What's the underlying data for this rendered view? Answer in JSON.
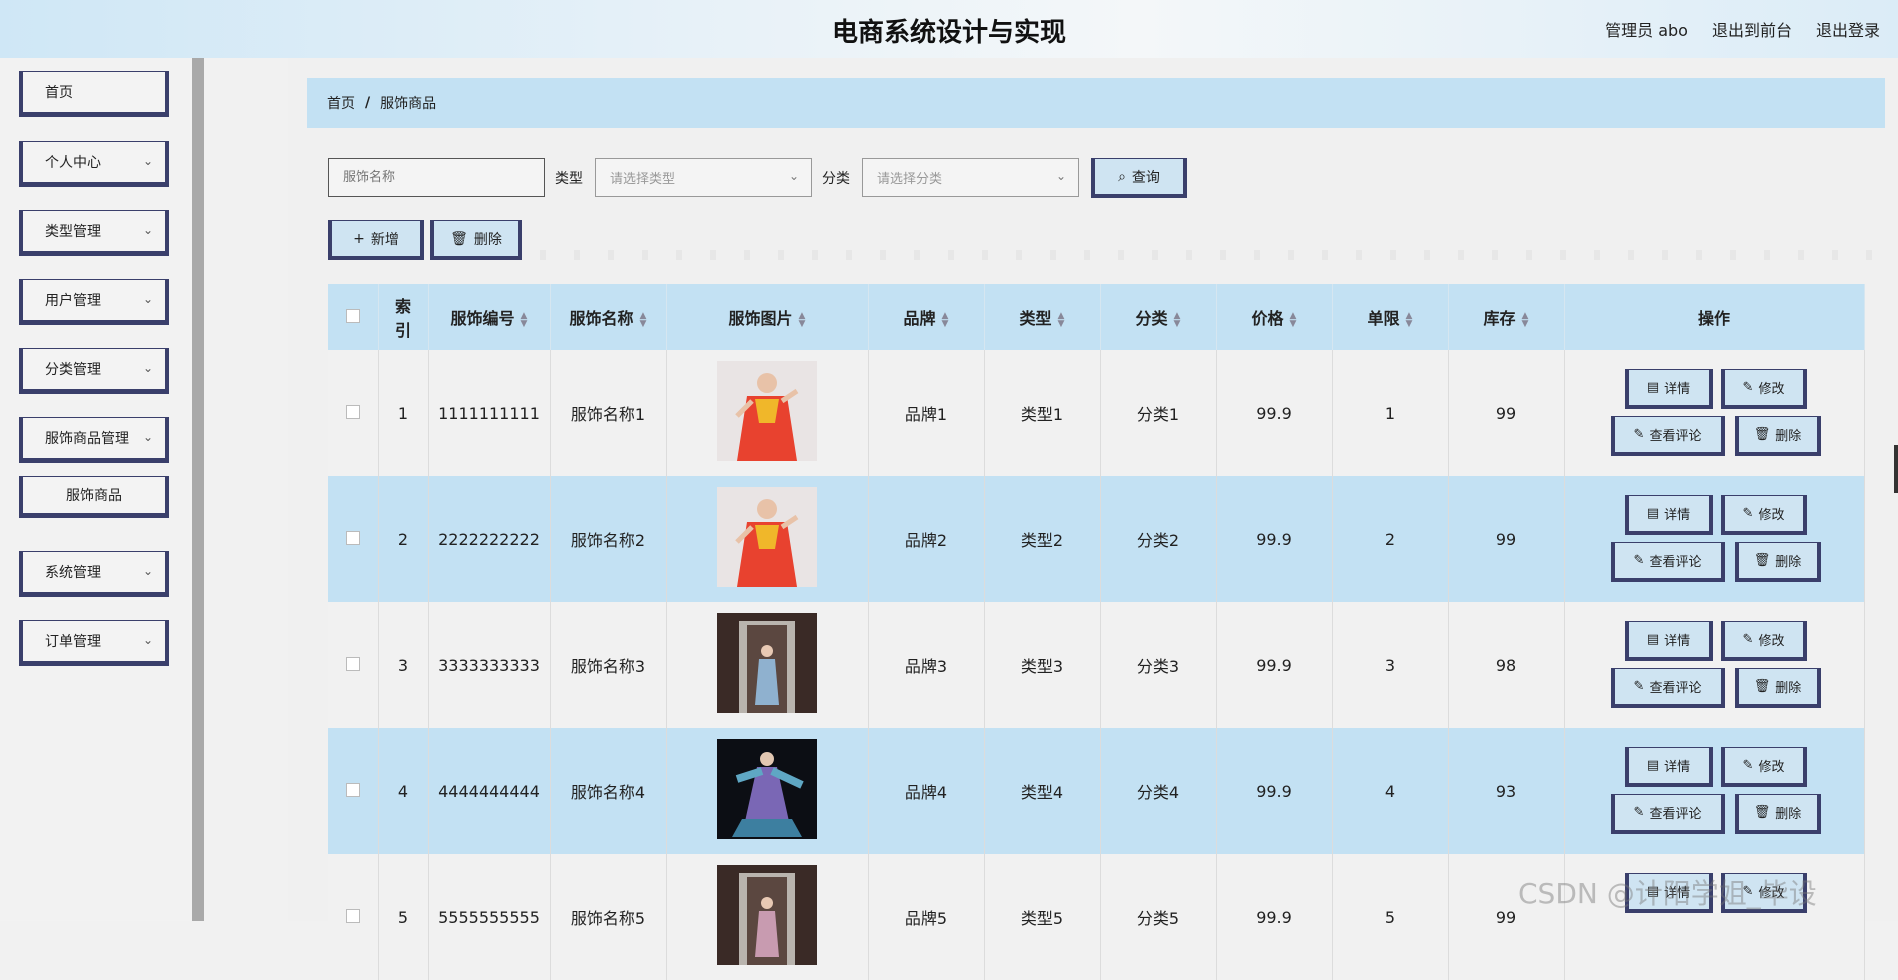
{
  "header": {
    "title": "电商系统设计与实现",
    "user": "管理员 abo",
    "to_front": "退出到前台",
    "logout": "退出登录"
  },
  "sidebar": {
    "items": [
      {
        "label": "首页",
        "chevron": false
      },
      {
        "label": "个人中心",
        "chevron": true
      },
      {
        "label": "类型管理",
        "chevron": true
      },
      {
        "label": "用户管理",
        "chevron": true
      },
      {
        "label": "分类管理",
        "chevron": true
      },
      {
        "label": "服饰商品管理",
        "chevron": true
      },
      {
        "label": "系统管理",
        "chevron": true
      },
      {
        "label": "订单管理",
        "chevron": true
      }
    ],
    "sub_item": "服饰商品"
  },
  "breadcrumb": {
    "home": "首页",
    "sep": "/",
    "current": "服饰商品"
  },
  "search": {
    "name_placeholder": "服饰名称",
    "type_label": "类型",
    "type_placeholder": "请选择类型",
    "category_label": "分类",
    "category_placeholder": "请选择分类",
    "query_button": "查询"
  },
  "actions": {
    "add": "新增",
    "delete": "删除"
  },
  "table": {
    "columns": [
      "索引",
      "服饰编号",
      "服饰名称",
      "服饰图片",
      "品牌",
      "类型",
      "分类",
      "价格",
      "单限",
      "库存",
      "操作"
    ],
    "index_header_top": "索",
    "index_header_bottom": "引",
    "rows": [
      {
        "index": "1",
        "code": "1111111111",
        "name": "服饰名称1",
        "brand": "品牌1",
        "type": "类型1",
        "category": "分类1",
        "price": "99.9",
        "limit": "1",
        "stock": "99"
      },
      {
        "index": "2",
        "code": "2222222222",
        "name": "服饰名称2",
        "brand": "品牌2",
        "type": "类型2",
        "category": "分类2",
        "price": "99.9",
        "limit": "2",
        "stock": "99"
      },
      {
        "index": "3",
        "code": "3333333333",
        "name": "服饰名称3",
        "brand": "品牌3",
        "type": "类型3",
        "category": "分类3",
        "price": "99.9",
        "limit": "3",
        "stock": "98"
      },
      {
        "index": "4",
        "code": "4444444444",
        "name": "服饰名称4",
        "brand": "品牌4",
        "type": "类型4",
        "category": "分类4",
        "price": "99.9",
        "limit": "4",
        "stock": "93"
      },
      {
        "index": "5",
        "code": "5555555555",
        "name": "服饰名称5",
        "brand": "品牌5",
        "type": "类型5",
        "category": "分类5",
        "price": "99.9",
        "limit": "5",
        "stock": "99"
      }
    ],
    "ops": {
      "detail": "详情",
      "edit": "修改",
      "review": "查看评论",
      "delete": "删除"
    }
  },
  "watermark": "CSDN @计阳学姐_毕设",
  "colors": {
    "accent": "#c3e1f3",
    "border": "#3a3f6b",
    "row_alt": "#f1f1f1"
  },
  "icons": {
    "thumb_red": "red-dress-photo",
    "thumb_dark": "dark-dress-photo"
  }
}
